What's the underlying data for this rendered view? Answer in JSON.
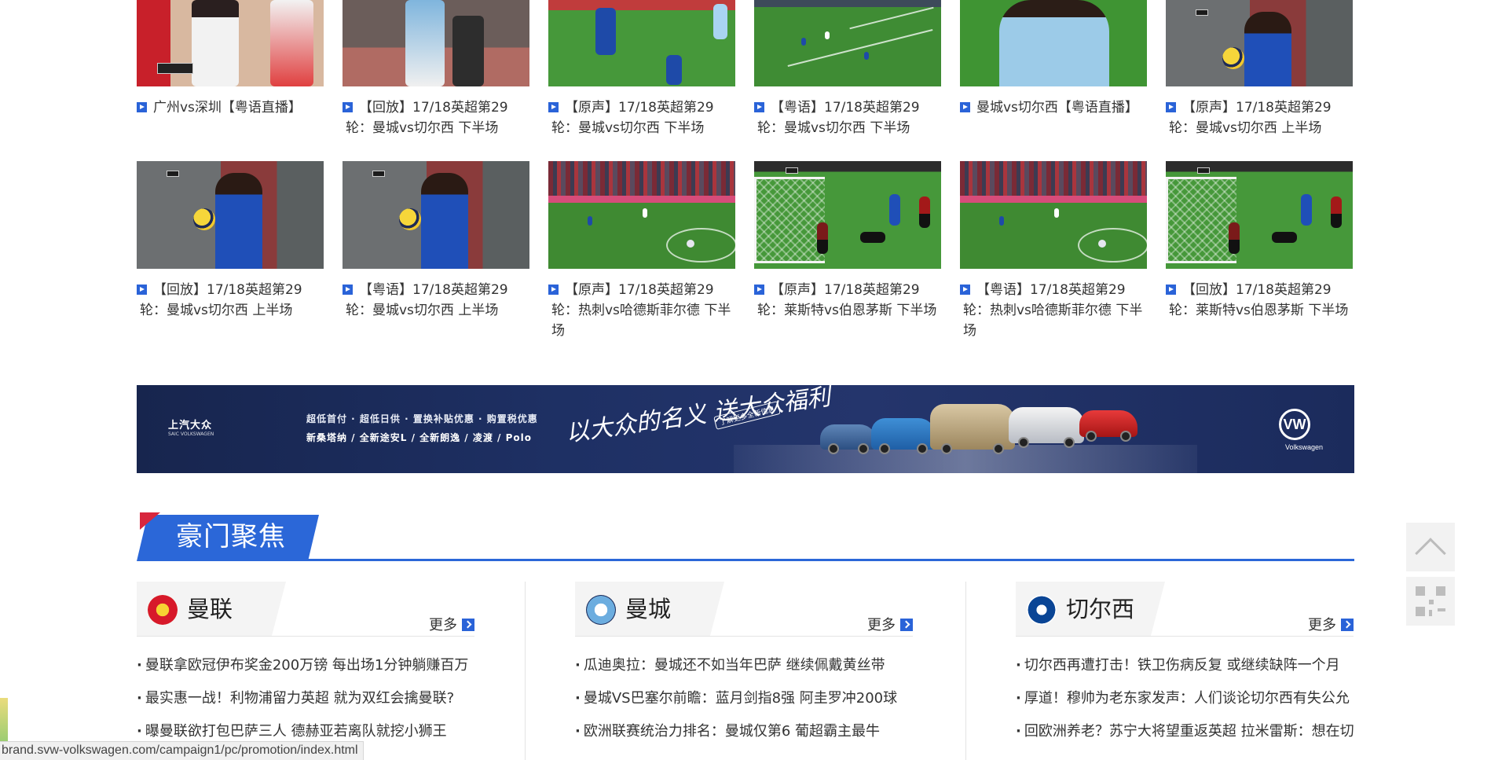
{
  "video_rows": [
    [
      {
        "line1": "广州vs深圳【粤语直播】",
        "line2": ""
      },
      {
        "line1": "【回放】17/18英超第29",
        "line2": "轮：曼城vs切尔西 下半场"
      },
      {
        "line1": "【原声】17/18英超第29",
        "line2": "轮：曼城vs切尔西 下半场"
      },
      {
        "line1": "【粤语】17/18英超第29",
        "line2": "轮：曼城vs切尔西 下半场"
      },
      {
        "line1": "曼城vs切尔西【粤语直播】",
        "line2": ""
      },
      {
        "line1": "【原声】17/18英超第29",
        "line2": "轮：曼城vs切尔西 上半场"
      }
    ],
    [
      {
        "line1": "【回放】17/18英超第29",
        "line2": "轮：曼城vs切尔西 上半场"
      },
      {
        "line1": "【粤语】17/18英超第29",
        "line2": "轮：曼城vs切尔西 上半场"
      },
      {
        "line1": "【原声】17/18英超第29",
        "line2": "轮：热刺vs哈德斯菲尔德 下半场"
      },
      {
        "line1": "【原声】17/18英超第29",
        "line2": "轮：莱斯特vs伯恩茅斯 下半场"
      },
      {
        "line1": "【粤语】17/18英超第29",
        "line2": "轮：热刺vs哈德斯菲尔德 下半场"
      },
      {
        "line1": "【回放】17/18英超第29",
        "line2": "轮：莱斯特vs伯恩茅斯 下半场"
      }
    ]
  ],
  "ad": {
    "brand": "上汽大众",
    "brand_en": "SAIC VOLKSWAGEN",
    "line1": "超低首付 · 超低日供 · 置换补贴优惠 · 购置税优惠",
    "line2": "新桑塔纳 / 全新途安L / 全新朗逸 / 凌渡 / Polo",
    "slogan": "以大众的名义 送大众福利",
    "slogan_tag": "了解更多全新信息",
    "vw_word": "Volkswagen",
    "vw_mark": "VW"
  },
  "section": {
    "title": "豪门聚焦"
  },
  "clubs": [
    {
      "name": "曼联",
      "more": "更多",
      "logo_color": "#d7192a",
      "news": [
        "曼联拿欧冠伊布奖金200万镑 每出场1分钟躺赚百万",
        "最实惠一战！利物浦留力英超 就为双红会擒曼联?",
        "曝曼联欲打包巴萨三人 德赫亚若离队就挖小狮王"
      ]
    },
    {
      "name": "曼城",
      "more": "更多",
      "logo_color": "#6caddf",
      "news": [
        "瓜迪奥拉：曼城还不如当年巴萨 继续佩戴黄丝带",
        "曼城VS巴塞尔前瞻：蓝月剑指8强 阿圭罗冲200球",
        "欧洲联赛统治力排名：曼城仅第6 葡超霸主最牛"
      ]
    },
    {
      "name": "切尔西",
      "more": "更多",
      "logo_color": "#0a4595",
      "news": [
        "切尔西再遭打击！铁卫伤病反复 或继续缺阵一个月",
        "厚道！穆帅为老东家发声：人们谈论切尔西有失公允",
        "回欧洲养老？苏宁大将望重返英超 拉米雷斯：想在切尔"
      ]
    }
  ],
  "status_url": "brand.svw-volkswagen.com/campaign1/pc/promotion/index.html",
  "colors": {
    "accent": "#2b67d8",
    "flag": "#d7263d",
    "ad_bg": "#1e3064"
  }
}
